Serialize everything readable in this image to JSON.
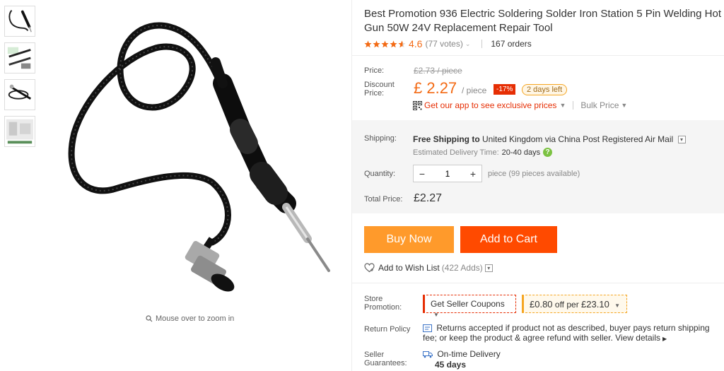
{
  "gallery": {
    "zoom_hint": "Mouse over to zoom in",
    "thumbnails": [
      "thumb-1",
      "thumb-2",
      "thumb-3",
      "thumb-4"
    ]
  },
  "product": {
    "title": "Best Promotion 936 Electric Soldering Solder Iron Station 5 Pin Welding Hot Gun 50W 24V Replacement Repair Tool",
    "rating": "4.6",
    "votes": "(77 votes)",
    "orders": "167 orders"
  },
  "price": {
    "price_label": "Price:",
    "original": "£2.73 / piece",
    "discount_label": "Discount Price:",
    "current": "£ 2.27",
    "unit": "/ piece",
    "percent_off": "-17%",
    "days_left": "2 days left",
    "app_promo": "Get our app to see exclusive prices",
    "bulk": "Bulk Price"
  },
  "shipping": {
    "label": "Shipping:",
    "free": "Free Shipping to",
    "destination": "United Kingdom via China Post Registered Air Mail",
    "estimated_label": "Estimated Delivery Time:",
    "estimated_days": "20-40 days"
  },
  "quantity": {
    "label": "Quantity:",
    "value": "1",
    "available": "piece (99 pieces available)"
  },
  "total": {
    "label": "Total Price:",
    "value": "£2.27"
  },
  "actions": {
    "buy_now": "Buy Now",
    "add_to_cart": "Add to Cart",
    "wishlist": "Add to Wish List",
    "wishlist_count": "(422 Adds)"
  },
  "store": {
    "promotion_label": "Store Promotion:",
    "coupon_button": "Get Seller Coupons",
    "coupon_amount": "£0.80",
    "coupon_off": "off per",
    "coupon_threshold": "£23.10",
    "return_label": "Return Policy",
    "return_text": "Returns accepted if product not as described, buyer pays return shipping fee; or keep the product & agree refund with seller.",
    "view_details": "View details",
    "guarantee_label": "Seller Guarantees:",
    "guarantee_text": "On-time Delivery",
    "guarantee_days": "45 days"
  },
  "colors": {
    "accent_orange": "#f36a14",
    "buy_now": "#ff9a2b",
    "add_to_cart": "#ff4a00",
    "discount_badge": "#e62e04"
  },
  "icons": [
    "magnifier-icon",
    "star-icon",
    "qr-code-icon",
    "help-icon",
    "heart-icon",
    "return-icon",
    "truck-icon",
    "chevron-down-icon"
  ]
}
